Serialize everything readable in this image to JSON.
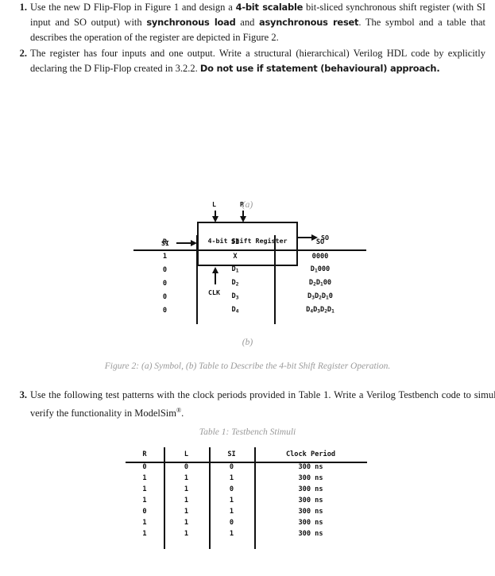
{
  "questions": [
    {
      "number": "1.",
      "segments": [
        {
          "text": "Use the new D Flip-Flop in Figure 1 and design a ",
          "bold": false
        },
        {
          "text": "4-bit scalable",
          "bold": true
        },
        {
          "text": " bit-sliced synchronous shift register (with SI input and SO output) with ",
          "bold": false
        },
        {
          "text": "synchronous load",
          "bold": true
        },
        {
          "text": " and ",
          "bold": false
        },
        {
          "text": "asynchronous reset",
          "bold": true
        },
        {
          "text": ". The symbol and a table that describes the operation of the register are depicted in Figure 2.",
          "bold": false
        }
      ]
    },
    {
      "number": "2.",
      "segments": [
        {
          "text": "The register has four inputs and one output. Write a structural (hierarchical) Verilog HDL code by explicitly declaring the D Flip-Flop created in 3.2.2. ",
          "bold": false
        },
        {
          "text": "Do not use if statement (behavioural) approach.",
          "bold": true
        }
      ]
    },
    {
      "number": "3.",
      "segments": [
        {
          "text": "Use the following test patterns with the clock periods provided in Table 1. Write a Verilog Testbench code to simulate and verify the functionality in ModelSim",
          "bold": false
        },
        {
          "text": "®",
          "bold": false,
          "sup": true
        },
        {
          "text": ".",
          "bold": false
        }
      ]
    }
  ],
  "figure": {
    "block_label": "4-bit Shift Register",
    "pins": {
      "left_input": "SI",
      "right_output": "SO",
      "top_left": "L",
      "top_right": "R",
      "bottom": "CLK"
    },
    "subcaption_a": "(a)",
    "subcaption_b": "(b)",
    "caption": "Figure 2: (a) Symbol, (b) Table to Describe the 4-bit Shift Register Operation."
  },
  "table_b": {
    "headers": [
      "R",
      "SI",
      "SO"
    ],
    "rows": [
      {
        "R": "1",
        "SI": "X",
        "SO": "0000"
      },
      {
        "R": "0",
        "SI": "D₁",
        "SO": "D₁0 0 0"
      },
      {
        "R": "0",
        "SI": "D₂",
        "SO": "D₂D₁00"
      },
      {
        "R": "0",
        "SI": "D₃",
        "SO": "D₃D₂D₁0"
      },
      {
        "R": "0",
        "SI": "D₄",
        "SO": "D₄D₃D₂D₁"
      }
    ],
    "rows_plain": [
      {
        "R": "1",
        "SI": "X",
        "SO": "0000"
      },
      {
        "R": "0",
        "SI": "D1",
        "SO": "D1000"
      },
      {
        "R": "0",
        "SI": "D2",
        "SO": "D2D100"
      },
      {
        "R": "0",
        "SI": "D3",
        "SO": "D3D2D10"
      },
      {
        "R": "0",
        "SI": "D4",
        "SO": "D4D3D2D1"
      }
    ]
  },
  "table_1": {
    "caption": "Table 1: Testbench Stimuli",
    "headers": [
      "R",
      "L",
      "SI",
      "Clock Period"
    ],
    "rows": [
      [
        "0",
        "0",
        "0",
        "300 ns"
      ],
      [
        "1",
        "1",
        "1",
        "300 ns"
      ],
      [
        "1",
        "1",
        "0",
        "300 ns"
      ],
      [
        "1",
        "1",
        "1",
        "300 ns"
      ],
      [
        "0",
        "1",
        "1",
        "300 ns"
      ],
      [
        "1",
        "1",
        "0",
        "300 ns"
      ],
      [
        "1",
        "1",
        "1",
        "300 ns"
      ]
    ]
  },
  "colors": {
    "text": "#1a1a1a",
    "caption_grey": "#9a9a9a",
    "rule": "#111111",
    "background": "#ffffff"
  }
}
